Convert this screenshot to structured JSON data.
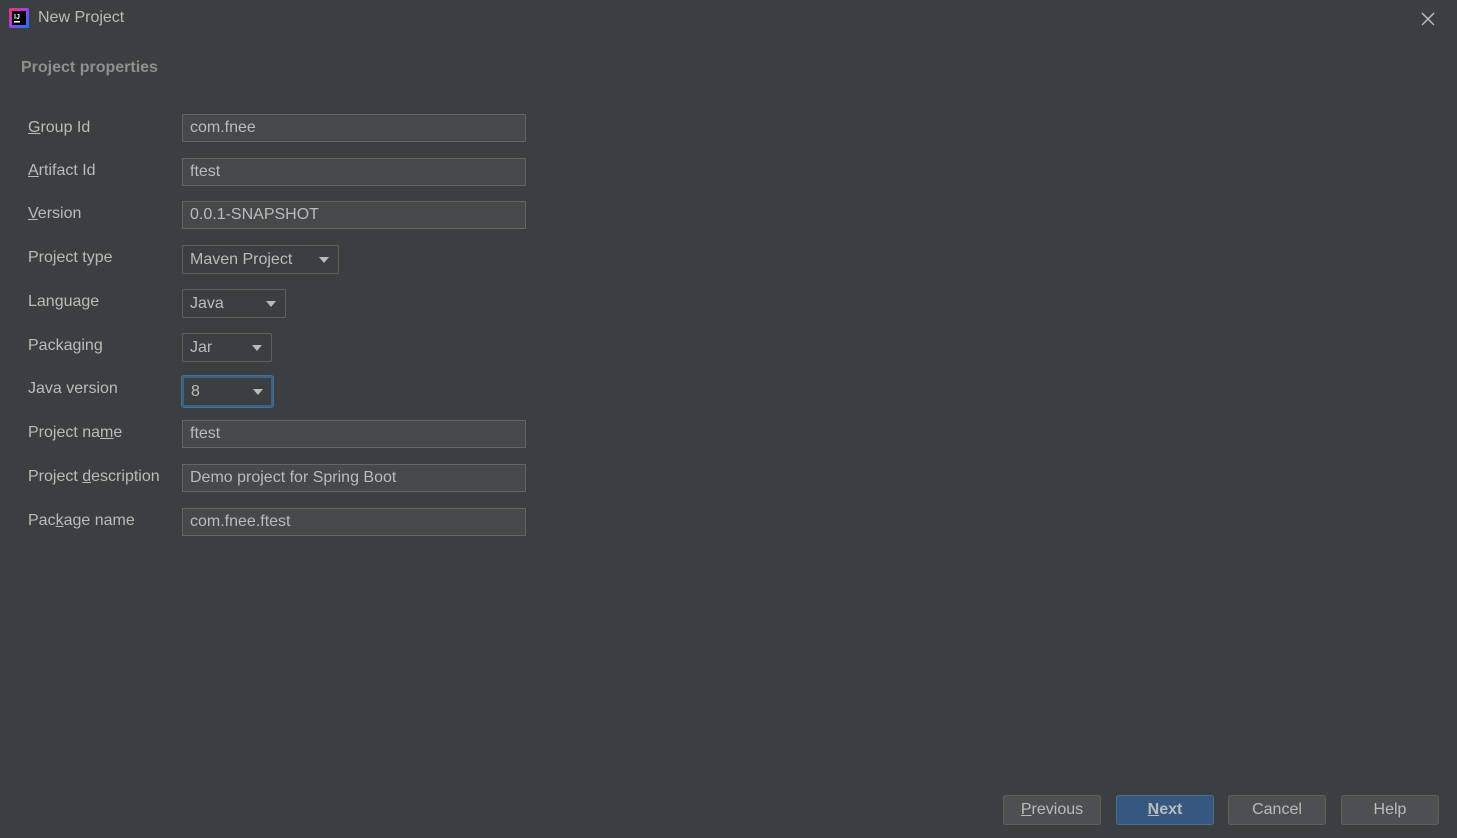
{
  "window": {
    "title": "New Project",
    "icon": "intellij-idea-icon",
    "close_icon": "close-icon"
  },
  "section": {
    "title": "Project properties"
  },
  "form": {
    "group_id": {
      "label": "Group Id",
      "mnemonic": "G",
      "rest": "roup Id",
      "value": "com.fnee"
    },
    "artifact_id": {
      "label": "Artifact Id",
      "mnemonic": "A",
      "rest": "rtifact Id",
      "value": "ftest"
    },
    "version": {
      "label": "Version",
      "mnemonic": "V",
      "rest": "ersion",
      "value": "0.0.1-SNAPSHOT"
    },
    "project_type": {
      "label": "Project type",
      "value": "Maven Project"
    },
    "language": {
      "label": "Language",
      "value": "Java"
    },
    "packaging": {
      "label": "Packaging",
      "value": "Jar"
    },
    "java_version": {
      "label": "Java version",
      "value": "8"
    },
    "project_name": {
      "label": "Project name",
      "pre": "Project na",
      "mnemonic": "m",
      "post": "e",
      "value": "ftest"
    },
    "project_description": {
      "label": "Project description",
      "pre": "Project ",
      "mnemonic": "d",
      "post": "escription",
      "value": "Demo project for Spring Boot"
    },
    "package_name": {
      "label": "Package name",
      "pre": "Pac",
      "mnemonic": "k",
      "post": "age name",
      "value": "com.fnee.ftest"
    }
  },
  "buttons": {
    "previous": {
      "label": "Previous",
      "mnemonic": "P",
      "rest": "revious"
    },
    "next": {
      "label": "Next",
      "mnemonic": "N",
      "rest": "ext"
    },
    "cancel": {
      "label": "Cancel"
    },
    "help": {
      "label": "Help"
    }
  },
  "colors": {
    "background": "#3c3f41",
    "text": "#bbbbbb",
    "input_background": "#45494a",
    "primary_button": "#365880",
    "focus_ring": "#3d6185"
  }
}
